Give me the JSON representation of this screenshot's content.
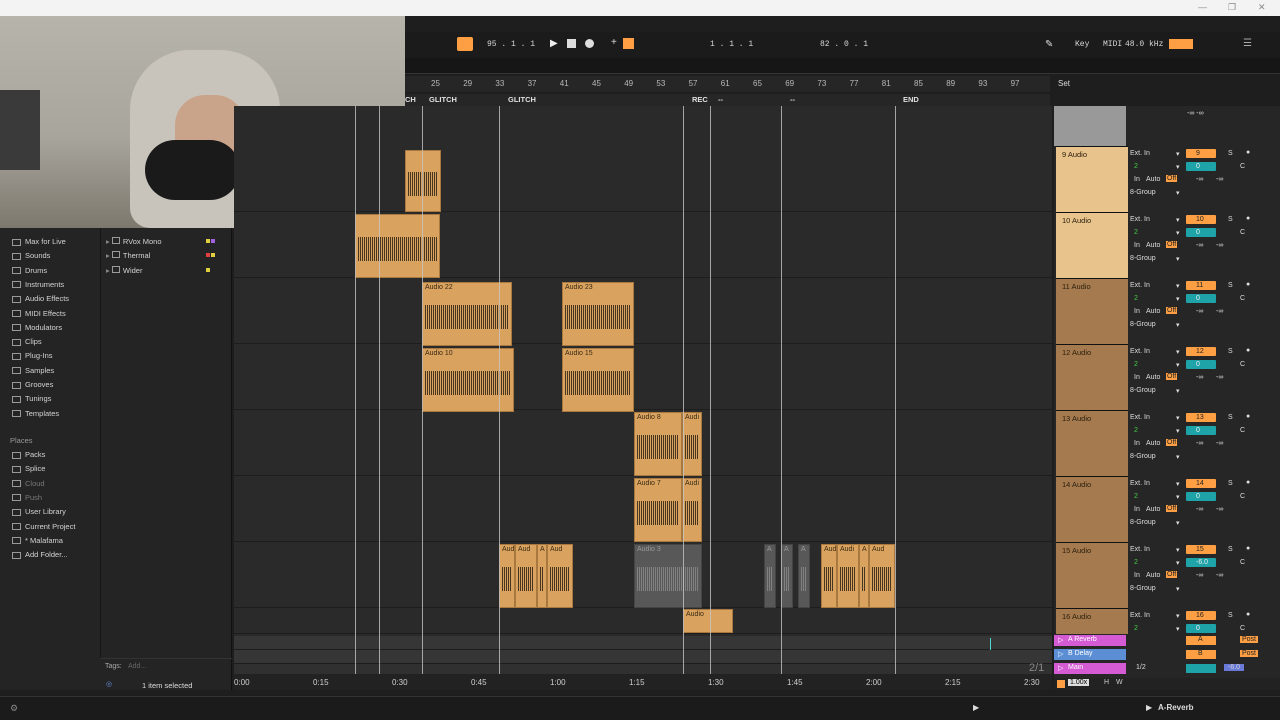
{
  "window": {
    "controls": [
      "—",
      "❐",
      "✕"
    ]
  },
  "transport": {
    "tempo": "95 . 1 . 1",
    "position": "1 . 1 . 1",
    "loop_len": "82 . 0 . 1",
    "key_label": "Key",
    "midi_label": "MIDI",
    "sample_rate": "48.0 kHz"
  },
  "ruler": {
    "bars": [
      "25",
      "29",
      "33",
      "37",
      "41",
      "45",
      "49",
      "53",
      "57",
      "61",
      "65",
      "69",
      "73",
      "77",
      "81",
      "85",
      "89",
      "93",
      "97"
    ],
    "set_label": "Set"
  },
  "locators": [
    {
      "label": "CH"
    },
    {
      "label": "GLITCH"
    },
    {
      "label": "GLITCH"
    },
    {
      "label": "REC"
    },
    {
      "label": "--"
    },
    {
      "label": "--"
    },
    {
      "label": "END"
    }
  ],
  "clips": {
    "audio22": "Audio 22",
    "audio23": "Audio 23",
    "audio10": "Audio 10",
    "audio15": "Audio 15",
    "audio8": "Audio 8",
    "audio7": "Audio 7",
    "audio3": "Audio 3",
    "aud": "Aud",
    "a": "A",
    "audio": "Audio",
    "audi": "Audi"
  },
  "timeaxis": [
    "0:00",
    "0:15",
    "0:30",
    "0:45",
    "1:00",
    "1:15",
    "1:30",
    "1:45",
    "2:00",
    "2:15",
    "2:30"
  ],
  "browser": {
    "categories": [
      "Max for Live",
      "Sounds",
      "Drums",
      "Instruments",
      "Audio Effects",
      "MIDI Effects",
      "Modulators",
      "Clips",
      "Plug-Ins",
      "Samples",
      "Grooves",
      "Tunings",
      "Templates"
    ],
    "places_header": "Places",
    "places": [
      "Packs",
      "Splice",
      "Cloud",
      "Push",
      "User Library",
      "Current Project",
      "* Malafama",
      "Add Folder..."
    ],
    "presets": [
      "RVox Mono",
      "Thermal",
      "Wider"
    ],
    "tags_label": "Tags:",
    "tags_placeholder": "Add...",
    "selection": "1 item selected"
  },
  "tracks": [
    {
      "name": "9 Audio",
      "num": "9"
    },
    {
      "name": "10 Audio",
      "num": "10"
    },
    {
      "name": "11 Audio",
      "num": "11"
    },
    {
      "name": "12 Audio",
      "num": "12"
    },
    {
      "name": "13 Audio",
      "num": "13"
    },
    {
      "name": "14 Audio",
      "num": "14"
    },
    {
      "name": "15 Audio",
      "num": "15"
    },
    {
      "name": "16 Audio",
      "num": "16"
    }
  ],
  "mixer": {
    "input": "Ext. In",
    "channel": "2",
    "in": "In",
    "auto": "Auto",
    "off": "Off",
    "route": "8-Group",
    "vol": "0",
    "pan": "C",
    "inf": "-∞",
    "s": "S",
    "vol15": "-6.0"
  },
  "returns": [
    {
      "name": "A Reverb",
      "btn": "A",
      "post": "Post",
      "color": "#d45bd4"
    },
    {
      "name": "B Delay",
      "btn": "B",
      "post": "Post",
      "color": "#5b8ed4"
    },
    {
      "name": "Main",
      "btn": "1/2",
      "vol": "-6.0",
      "color": "#d45bd4"
    }
  ],
  "overview": {
    "pages": "2/1",
    "zoom": "1.00x",
    "h": "H",
    "w": "W"
  },
  "status": {
    "device": "A-Reverb"
  }
}
